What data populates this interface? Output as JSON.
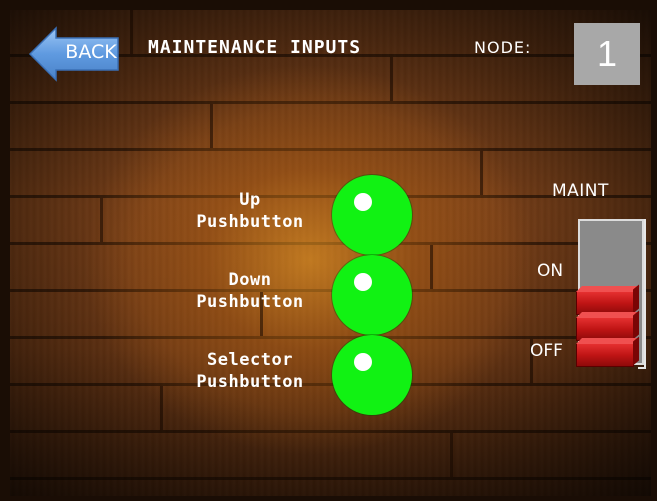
{
  "header": {
    "back_label": "BACK",
    "title": "MAINTENANCE INPUTS",
    "node_label": "NODE:",
    "node_value": "1"
  },
  "inputs": [
    {
      "line1": "Up",
      "line2": "Pushbutton",
      "state": "on"
    },
    {
      "line1": "Down",
      "line2": "Pushbutton",
      "state": "on"
    },
    {
      "line1": "Selector",
      "line2": "Pushbutton",
      "state": "on"
    }
  ],
  "maint_switch": {
    "label": "MAINT",
    "on_label": "ON",
    "off_label": "OFF",
    "position": "OFF"
  },
  "colors": {
    "indicator_on": "#11f213",
    "back_button": "#6aa4e8",
    "node_box": "#a8a8a8",
    "switch_handle": "#c01515"
  },
  "icons": {
    "back": "left-arrow-icon"
  }
}
